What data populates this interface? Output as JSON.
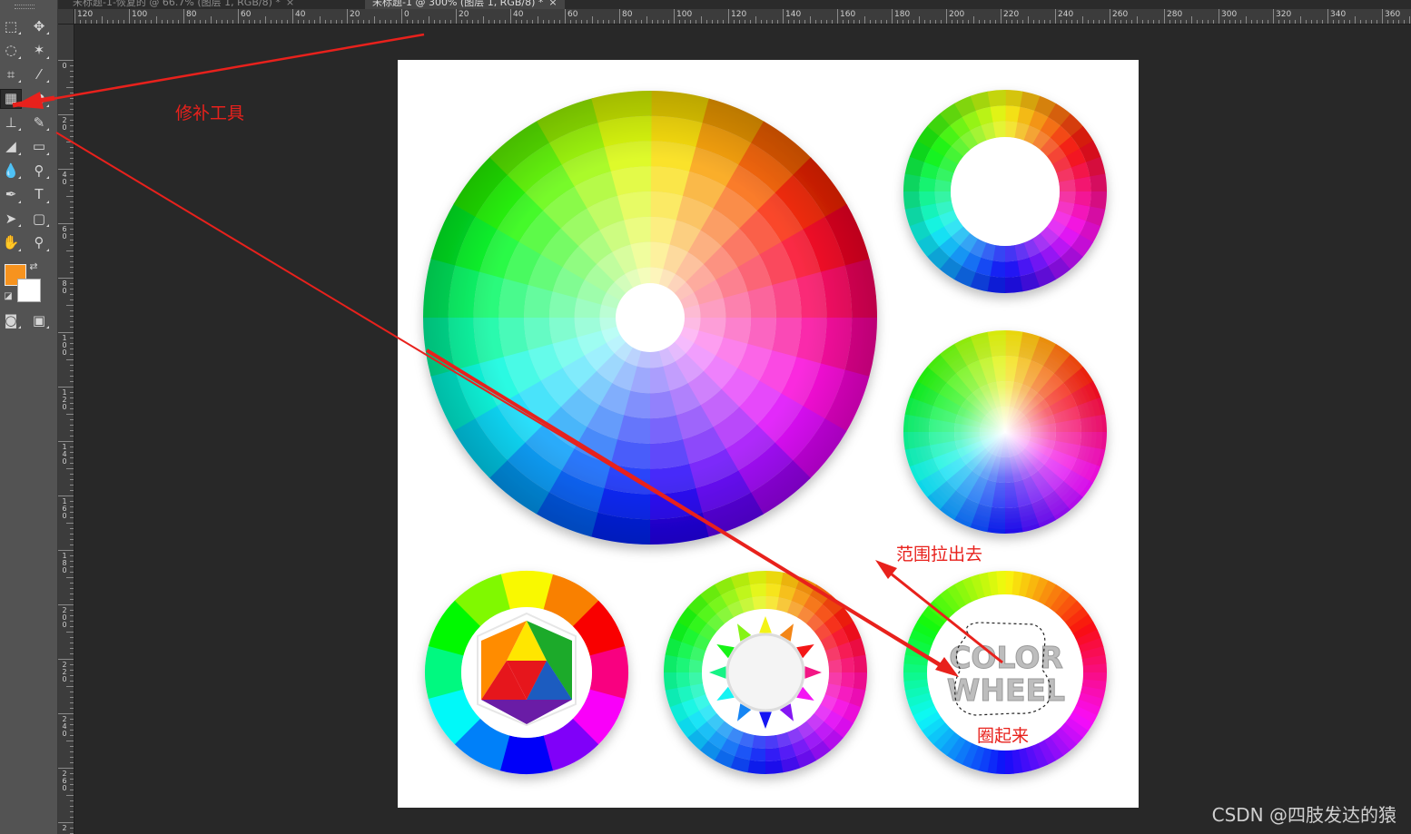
{
  "tabs": [
    {
      "label": "未标题-1-恢复的 @ 66.7% (图层 1, RGB/8) *",
      "close": "×"
    },
    {
      "label": "未标题-1 @ 300% (图层 1, RGB/8) *",
      "close": "×"
    }
  ],
  "ruler_top": [
    "120",
    "100",
    "80",
    "60",
    "40",
    "20",
    "0",
    "20",
    "40",
    "60",
    "80",
    "100",
    "120",
    "140",
    "160",
    "180",
    "200",
    "220",
    "240",
    "260",
    "280",
    "300",
    "320",
    "340",
    "360"
  ],
  "ruler_left": [
    "0",
    "20",
    "40",
    "60",
    "80",
    "100",
    "120",
    "140",
    "160",
    "180",
    "200",
    "220",
    "240",
    "260",
    "2"
  ],
  "toolbar": {
    "tools": [
      {
        "name": "rectangular-marquee-tool-icon",
        "glyph": "⬚"
      },
      {
        "name": "move-tool-icon",
        "glyph": "✥"
      },
      {
        "name": "lasso-tool-icon",
        "glyph": "◌"
      },
      {
        "name": "magic-wand-tool-icon",
        "glyph": "✶"
      },
      {
        "name": "crop-tool-icon",
        "glyph": "⌗"
      },
      {
        "name": "eyedropper-tool-icon",
        "glyph": "⁄"
      },
      {
        "name": "patch-tool-icon",
        "glyph": "▦"
      },
      {
        "name": "brush-tool-icon",
        "glyph": "●"
      },
      {
        "name": "clone-stamp-tool-icon",
        "glyph": "⊥"
      },
      {
        "name": "history-brush-tool-icon",
        "glyph": "✎"
      },
      {
        "name": "eraser-tool-icon",
        "glyph": "◢"
      },
      {
        "name": "gradient-tool-icon",
        "glyph": "▭"
      },
      {
        "name": "blur-tool-icon",
        "glyph": "💧"
      },
      {
        "name": "dodge-tool-icon",
        "glyph": "⚲"
      },
      {
        "name": "pen-tool-icon",
        "glyph": "✒"
      },
      {
        "name": "type-tool-icon",
        "glyph": "T"
      },
      {
        "name": "path-selection-tool-icon",
        "glyph": "➤"
      },
      {
        "name": "shape-tool-icon",
        "glyph": "▢"
      },
      {
        "name": "hand-tool-icon",
        "glyph": "✋"
      },
      {
        "name": "zoom-tool-icon",
        "glyph": "⚲"
      },
      {
        "name": "quick-mask-icon",
        "glyph": "◙"
      },
      {
        "name": "screen-mode-icon",
        "glyph": "▣"
      }
    ],
    "foreground_color": "#f7931e",
    "background_color": "#ffffff"
  },
  "canvas": {
    "wheel_text_line1": "COLOR",
    "wheel_text_line2": "WHEEL"
  },
  "annotations": {
    "patch_tool": "修补工具",
    "drag_out": "范围拉出去",
    "circle_it": "圈起来",
    "color": "#e8211c"
  },
  "watermark": "CSDN @四肢发达的猿"
}
